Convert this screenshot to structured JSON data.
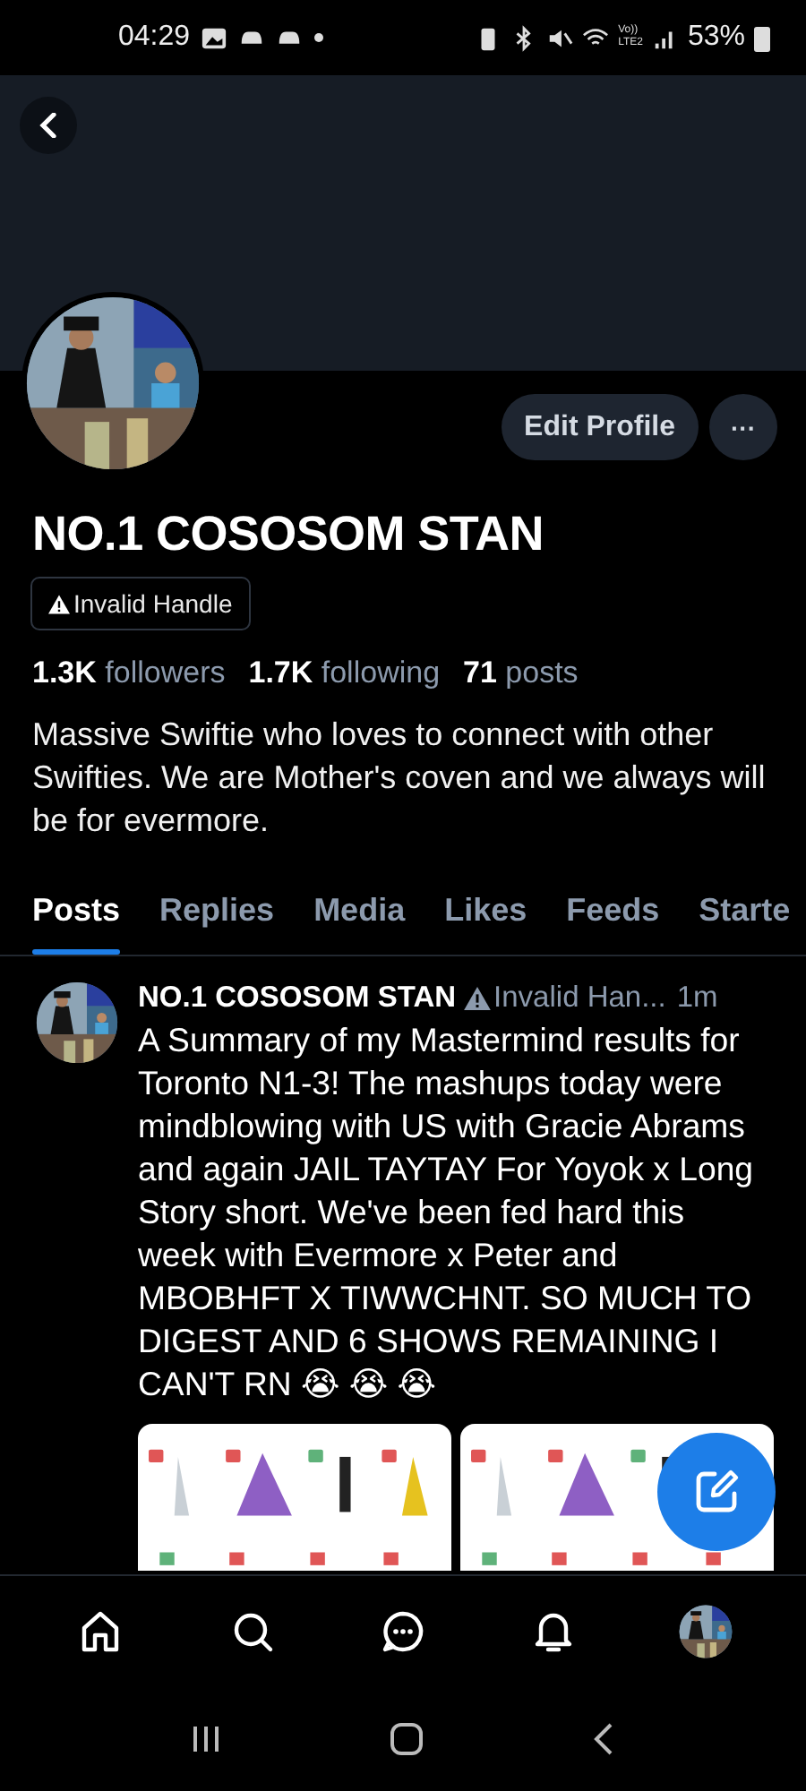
{
  "status_bar": {
    "time": "04:29",
    "volte": "Vo))",
    "network": "LTE2",
    "battery": "53%"
  },
  "profile": {
    "name": "NO.1 COSOSOM STAN",
    "handle": "Invalid Handle",
    "edit_button": "Edit Profile",
    "more_button": "···",
    "stats": [
      "**1.3K** followers",
      "**1.7K** following",
      "**71** posts"
    ],
    "bio": "Massive Swiftie who loves to connect with other Swifties. We are Mother's coven and we always will be for evermore."
  },
  "tabs": [
    {
      "label": "Posts",
      "selected": true
    },
    {
      "label": "Replies",
      "selected": false
    },
    {
      "label": "Media",
      "selected": false
    },
    {
      "label": "Likes",
      "selected": false
    },
    {
      "label": "Feeds",
      "selected": false
    },
    {
      "label": "Starte",
      "selected": false
    }
  ],
  "post": {
    "author": "NO.1 COSOSOM STAN",
    "handle": "Invalid Han...",
    "time": "1m",
    "text": "A Summary of my Mastermind results for Toronto N1-3! The mashups today were mindblowing with US with Gracie Abrams and again JAIL TAYTAY For Yoyok x Long Story short. We've been fed hard this week with Evermore x Peter and MBOBHFT X TIWWCHNT. SO MUCH TO DIGEST AND 6 SHOWS REMAINING I CAN'T RN 😭 😭 😭"
  },
  "bottom_nav": [
    {
      "kind": "home"
    },
    {
      "kind": "search"
    },
    {
      "kind": "chat"
    },
    {
      "kind": "bell"
    },
    {
      "kind": "avatar"
    }
  ]
}
